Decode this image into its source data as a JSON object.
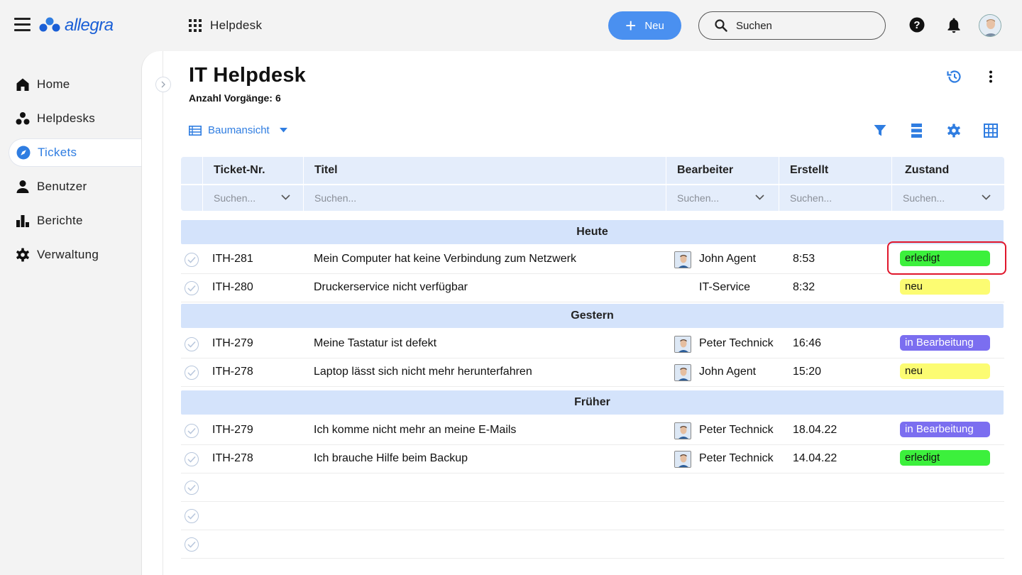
{
  "header": {
    "brand": "allegra",
    "app": "Helpdesk",
    "new_label": "Neu",
    "search_label": "Suchen",
    "colors": {
      "accent": "#4a90f0",
      "brand": "#1a5fd6"
    }
  },
  "sidebar": {
    "items": [
      {
        "label": "Home",
        "icon": "home-icon"
      },
      {
        "label": "Helpdesks",
        "icon": "helpdesks-icon"
      },
      {
        "label": "Tickets",
        "icon": "compass-icon",
        "active": true
      },
      {
        "label": "Benutzer",
        "icon": "user-icon"
      },
      {
        "label": "Berichte",
        "icon": "bar-chart-icon"
      },
      {
        "label": "Verwaltung",
        "icon": "gear-icon"
      }
    ]
  },
  "main": {
    "title": "IT Helpdesk",
    "count_label": "Anzahl Vorgänge:",
    "count_value": "6",
    "view_label": "Baumansicht"
  },
  "table": {
    "columns": [
      "Ticket-Nr.",
      "Titel",
      "Bearbeiter",
      "Erstellt",
      "Zustand"
    ],
    "filter_placeholder": "Suchen...",
    "groups": [
      {
        "label": "Heute"
      },
      {
        "label": "Gestern"
      },
      {
        "label": "Früher"
      }
    ],
    "rows": [
      {
        "id": "ITH-281",
        "title": "Mein Computer hat keine Verbindung zum Netzwerk",
        "assignee": "John Agent",
        "created": "8:53",
        "status": "erledigt",
        "status_color": "#3cf03c"
      },
      {
        "id": "ITH-280",
        "title": "Druckerservice nicht verfügbar",
        "assignee": "IT-Service",
        "created": "8:32",
        "status": "neu",
        "status_color": "#fcfc72"
      },
      {
        "id": "ITH-279",
        "title": "Meine Tastatur ist defekt",
        "assignee": "Peter Technick",
        "created": "16:46",
        "status": "in Bearbeitung",
        "status_color": "#7b6ef0"
      },
      {
        "id": "ITH-278",
        "title": "Laptop lässt sich nicht mehr herunterfahren",
        "assignee": "John Agent",
        "created": "15:20",
        "status": "neu",
        "status_color": "#fcfc72"
      },
      {
        "id": "ITH-279",
        "title": "Ich komme nicht mehr an meine E-Mails",
        "assignee": "Peter Technick",
        "created": "18.04.22",
        "status": "in Bearbeitung",
        "status_color": "#7b6ef0"
      },
      {
        "id": "ITH-278",
        "title": "Ich brauche Hilfe beim Backup",
        "assignee": "Peter Technick",
        "created": "14.04.22",
        "status": "erledigt",
        "status_color": "#3cf03c"
      }
    ]
  }
}
